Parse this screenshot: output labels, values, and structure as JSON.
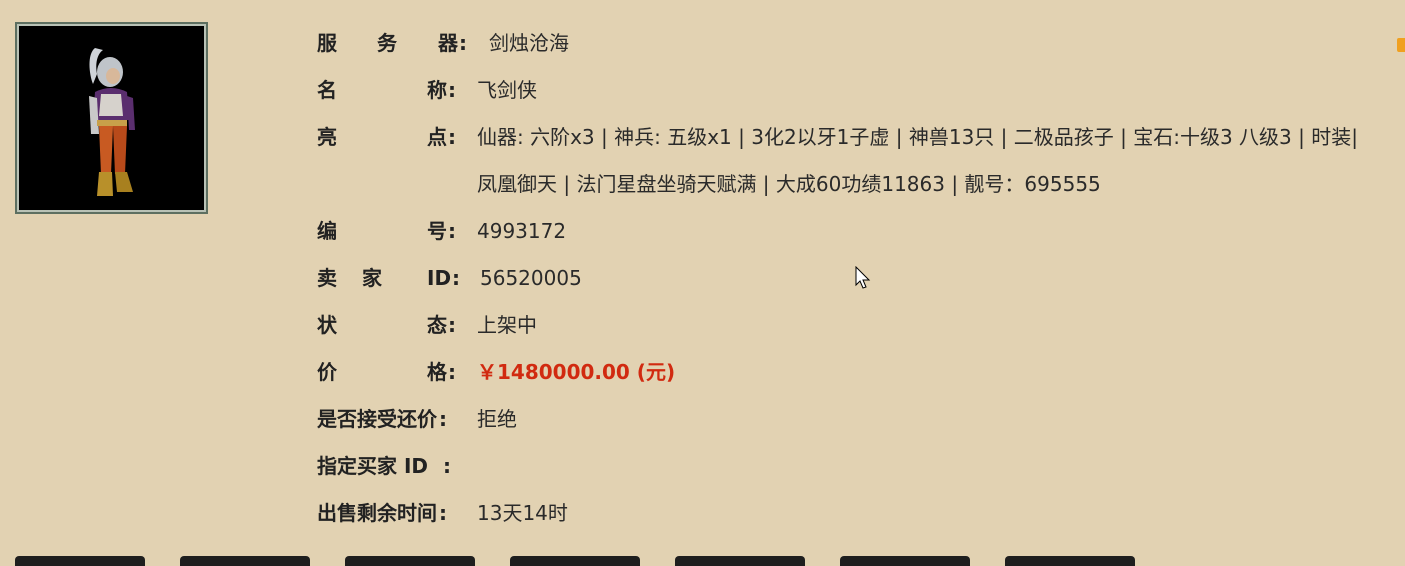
{
  "detail": {
    "server": {
      "label": [
        "服",
        "务",
        "器"
      ],
      "value": "剑烛沧海"
    },
    "name": {
      "label": [
        "名",
        "称"
      ],
      "value": "飞剑侠"
    },
    "highlights": {
      "label": [
        "亮",
        "点"
      ],
      "line1": "仙器: 六阶x3 | 神兵: 五级x1 | 3化2以牙1子虚 | 神兽13只 | 二极品孩子 | 宝石:十级3 八级3 | 时装|",
      "line2": "凤凰御天 | 法门星盘坐骑天赋满 | 大成60功绩11863 | 靓号：695555"
    },
    "number": {
      "label": [
        "编",
        "号"
      ],
      "value": "4993172"
    },
    "seller_id": {
      "label": [
        "卖",
        "家",
        "ID"
      ],
      "value": "56520005"
    },
    "status": {
      "label": [
        "状",
        "态"
      ],
      "value": "上架中"
    },
    "price": {
      "label": [
        "价",
        "格"
      ],
      "value": "￥1480000.00 (元)"
    },
    "counter_offer": {
      "label": "是否接受还价",
      "value": "拒绝"
    },
    "designated_buyer": {
      "label": "指定买家 ID",
      "value": ""
    },
    "remaining_time": {
      "label": "出售剩余时间",
      "value": "13天14时"
    }
  },
  "colon": ":",
  "colors": {
    "background": "#e2d2b2",
    "price": "#d12a10",
    "avatar_bg": "#000000"
  },
  "icons": {
    "avatar": "character-portrait-icon",
    "corner": "orange-tab-icon",
    "cursor": "mouse-pointer-icon"
  }
}
